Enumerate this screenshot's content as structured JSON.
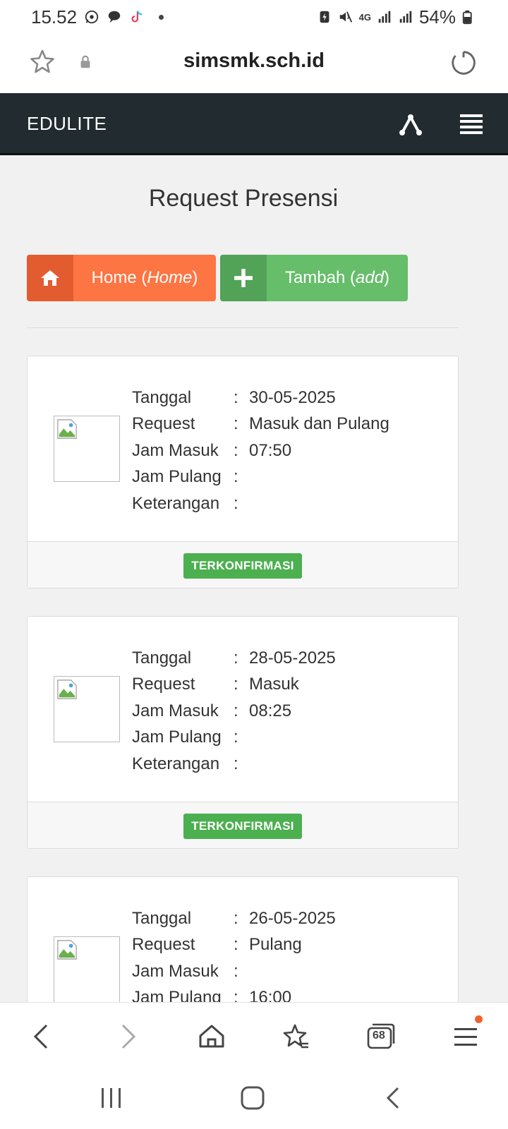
{
  "status_bar": {
    "time": "15.52",
    "battery": "54%",
    "network": "4G",
    "icons": [
      "whatsapp-icon",
      "chat-icon",
      "tiktok-icon",
      "dot-icon",
      "battery-saver-icon",
      "mute-icon",
      "network-4g-icon",
      "signal-icon",
      "signal-icon",
      "battery-icon"
    ]
  },
  "browser": {
    "url": "simsmk.sch.id",
    "tabs_count": "68",
    "icons": [
      "star-icon",
      "lock-icon",
      "reload-icon",
      "back-icon",
      "forward-icon",
      "home-icon",
      "bookmarks-icon",
      "tabs-icon",
      "menu-icon"
    ]
  },
  "navbar": {
    "brand": "EDULITE",
    "icons": [
      "share-icon",
      "hamburger-menu-icon"
    ]
  },
  "page": {
    "title": "Request Presensi",
    "home_button": {
      "text": "Home (",
      "italic": "Home",
      "close": ")"
    },
    "add_button": {
      "text": "Tambah (",
      "italic": "add",
      "close": ")"
    }
  },
  "labels": {
    "tanggal": "Tanggal",
    "request": "Request",
    "jam_masuk": "Jam Masuk",
    "jam_pulang": "Jam Pulang",
    "keterangan": "Keterangan",
    "colon": ":"
  },
  "records": [
    {
      "tanggal": "30-05-2025",
      "request": "Masuk dan Pulang",
      "jam_masuk": "07:50",
      "jam_pulang": "",
      "keterangan": "",
      "status": "TERKONFIRMASI"
    },
    {
      "tanggal": "28-05-2025",
      "request": "Masuk",
      "jam_masuk": "08:25",
      "jam_pulang": "",
      "keterangan": "",
      "status": "TERKONFIRMASI"
    },
    {
      "tanggal": "26-05-2025",
      "request": "Pulang",
      "jam_masuk": "",
      "jam_pulang": "16:00",
      "keterangan": "",
      "status": ""
    }
  ],
  "colors": {
    "navbar_bg": "#212b30",
    "home_button": "#fd7543",
    "add_button": "#66bd6a",
    "badge": "#4caf50",
    "notification": "#f0622c"
  }
}
